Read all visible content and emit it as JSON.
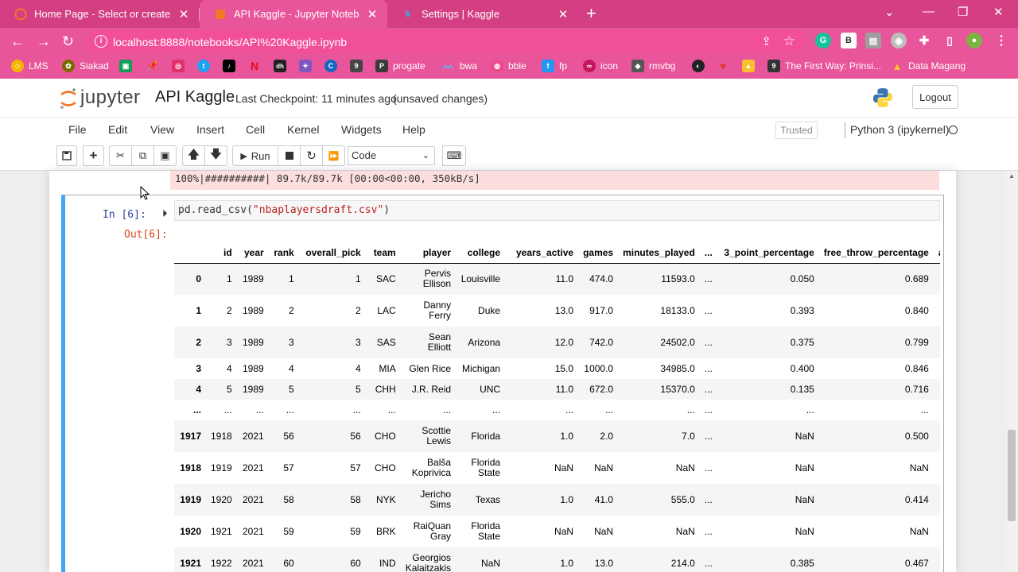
{
  "browser": {
    "tabs": [
      {
        "title": "Home Page - Select or create a n",
        "icon": "jupyter-icon"
      },
      {
        "title": "API Kaggle - Jupyter Notebook",
        "icon": "jupyter-icon"
      },
      {
        "title": "Settings | Kaggle",
        "icon": "kaggle-icon"
      }
    ],
    "url": "localhost:8888/notebooks/API%20Kaggle.ipynb",
    "bookmarks": [
      {
        "label": "LMS",
        "color": "#f5b400"
      },
      {
        "label": "Siakad",
        "color": "#7a6b00"
      },
      {
        "label": "",
        "color": "#d33f82"
      },
      {
        "label": "",
        "color": "#e1306c"
      },
      {
        "label": "",
        "color": "#1da1f2"
      },
      {
        "label": "",
        "color": "#000000"
      },
      {
        "label": "",
        "color": "#e50914"
      },
      {
        "label": "",
        "color": "#222222"
      },
      {
        "label": "",
        "color": "#7e57c2"
      },
      {
        "label": "",
        "color": "#1565c0"
      },
      {
        "label": "",
        "color": "#444444"
      },
      {
        "label": "progate",
        "color": "#3a3a3a"
      },
      {
        "label": "bwa",
        "color": "#4285f4"
      },
      {
        "label": "bble",
        "color": "#ea4c89"
      },
      {
        "label": "fp",
        "color": "#2196f3"
      },
      {
        "label": "icon",
        "color": "#c2185b"
      },
      {
        "label": "rmvbg",
        "color": "#555555"
      },
      {
        "label": "",
        "color": "#222222"
      },
      {
        "label": "",
        "color": "#e53935"
      },
      {
        "label": "",
        "color": "#fbc02d"
      },
      {
        "label": "The First Way: Prinsi...",
        "color": "#333333"
      },
      {
        "label": "Data Magang",
        "color": "#0f9d58"
      }
    ]
  },
  "jupyter": {
    "logo_text": "jupyter",
    "notebook_name": "API Kaggle",
    "checkpoint": "Last Checkpoint: 11 minutes ago",
    "unsaved": "(unsaved changes)",
    "logout_label": "Logout",
    "menu": [
      "File",
      "Edit",
      "View",
      "Insert",
      "Cell",
      "Kernel",
      "Widgets",
      "Help"
    ],
    "trusted_label": "Trusted",
    "kernel_name": "Python 3 (ipykernel)",
    "run_label": "Run",
    "cell_type": "Code"
  },
  "notebook": {
    "stderr_text": "100%|##########| 89.7k/89.7k [00:00<00:00, 350kB/s]",
    "cell_prompt": "In [6]:",
    "code_prefix": "pd.read_csv(",
    "code_string": "\"nbaplayersdraft.csv\"",
    "code_suffix": ")",
    "out_prompt": "Out[6]:"
  },
  "dataframe": {
    "columns": [
      "",
      "id",
      "year",
      "rank",
      "overall_pick",
      "team",
      "player",
      "college",
      "years_active",
      "games",
      "minutes_played",
      "...",
      "3_point_percentage",
      "free_throw_percentage",
      "aver"
    ],
    "rows": [
      {
        "idx": "0",
        "cells": [
          "1",
          "1989",
          "1",
          "1",
          "SAC",
          "Pervis Ellison",
          "Louisville",
          "11.0",
          "474.0",
          "11593.0",
          "...",
          "0.050",
          "0.689"
        ],
        "tall": true
      },
      {
        "idx": "1",
        "cells": [
          "2",
          "1989",
          "2",
          "2",
          "LAC",
          "Danny Ferry",
          "Duke",
          "13.0",
          "917.0",
          "18133.0",
          "...",
          "0.393",
          "0.840"
        ],
        "tall": true
      },
      {
        "idx": "2",
        "cells": [
          "3",
          "1989",
          "3",
          "3",
          "SAS",
          "Sean Elliott",
          "Arizona",
          "12.0",
          "742.0",
          "24502.0",
          "...",
          "0.375",
          "0.799"
        ],
        "tall": true
      },
      {
        "idx": "3",
        "cells": [
          "4",
          "1989",
          "4",
          "4",
          "MIA",
          "Glen Rice",
          "Michigan",
          "15.0",
          "1000.0",
          "34985.0",
          "...",
          "0.400",
          "0.846"
        ],
        "tall": false
      },
      {
        "idx": "4",
        "cells": [
          "5",
          "1989",
          "5",
          "5",
          "CHH",
          "J.R. Reid",
          "UNC",
          "11.0",
          "672.0",
          "15370.0",
          "...",
          "0.135",
          "0.716"
        ],
        "tall": false
      },
      {
        "idx": "...",
        "cells": [
          "...",
          "...",
          "...",
          "...",
          "...",
          "...",
          "...",
          "...",
          "...",
          "...",
          "...",
          "...",
          "..."
        ],
        "tall": false
      },
      {
        "idx": "1917",
        "cells": [
          "1918",
          "2021",
          "56",
          "56",
          "CHO",
          "Scottie Lewis",
          "Florida",
          "1.0",
          "2.0",
          "7.0",
          "...",
          "NaN",
          "0.500"
        ],
        "tall": true
      },
      {
        "idx": "1918",
        "cells": [
          "1919",
          "2021",
          "57",
          "57",
          "CHO",
          "Balša Koprivica",
          "Florida State",
          "NaN",
          "NaN",
          "NaN",
          "...",
          "NaN",
          "NaN"
        ],
        "tall": true
      },
      {
        "idx": "1919",
        "cells": [
          "1920",
          "2021",
          "58",
          "58",
          "NYK",
          "Jericho Sims",
          "Texas",
          "1.0",
          "41.0",
          "555.0",
          "...",
          "NaN",
          "0.414"
        ],
        "tall": true
      },
      {
        "idx": "1920",
        "cells": [
          "1921",
          "2021",
          "59",
          "59",
          "BRK",
          "RaiQuan Gray",
          "Florida State",
          "NaN",
          "NaN",
          "NaN",
          "...",
          "NaN",
          "NaN"
        ],
        "tall": true
      },
      {
        "idx": "1921",
        "cells": [
          "1922",
          "2021",
          "60",
          "60",
          "IND",
          "Georgios Kalaitzakis",
          "NaN",
          "1.0",
          "13.0",
          "214.0",
          "...",
          "0.385",
          "0.467"
        ],
        "tall": true
      }
    ]
  },
  "colors": {
    "tabbar": "#d33f82",
    "chrome": "#e8559a",
    "cell_border_selected": "#42a5f5",
    "stderr_bg": "#fddede"
  }
}
